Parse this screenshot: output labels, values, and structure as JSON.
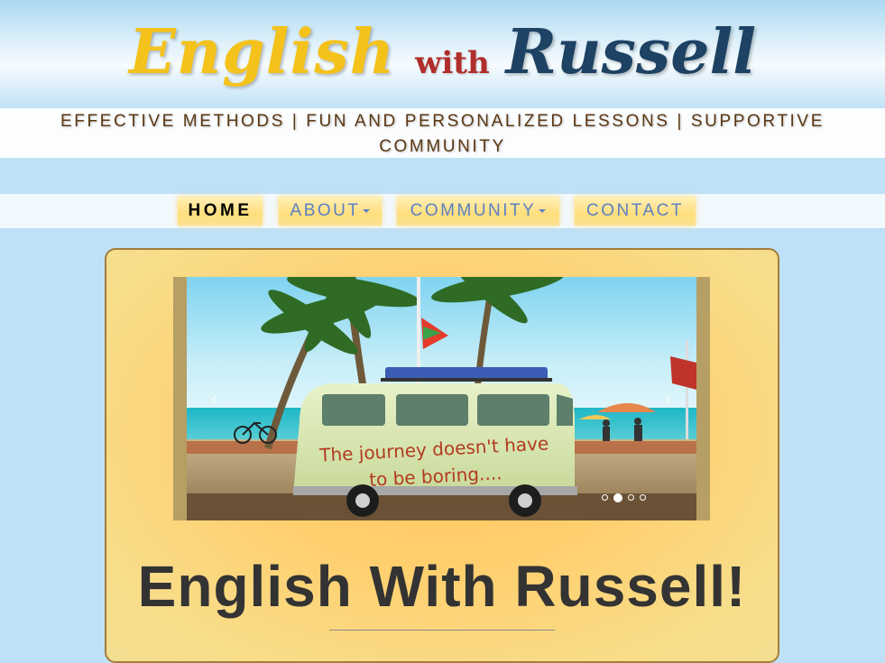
{
  "header": {
    "title_english": "English",
    "title_with": "with",
    "title_russell": "Russell",
    "tagline": "EFFECTIVE METHODS | FUN AND PERSONALIZED LESSONS | SUPPORTIVE COMMUNITY"
  },
  "nav": {
    "items": [
      {
        "label": "HOME",
        "active": true,
        "has_dropdown": false
      },
      {
        "label": "ABOUT",
        "active": false,
        "has_dropdown": true
      },
      {
        "label": "COMMUNITY",
        "active": false,
        "has_dropdown": true
      },
      {
        "label": "CONTACT",
        "active": false,
        "has_dropdown": false
      }
    ]
  },
  "slider": {
    "caption_line1": "The journey doesn't have",
    "caption_line2": "to be boring....",
    "prev_icon": "chevron-left-icon",
    "next_icon": "chevron-right-icon",
    "slide_count": 4,
    "active_slide": 2
  },
  "main": {
    "heading": "English With Russell!"
  },
  "colors": {
    "title_english": "#f4c21a",
    "title_with": "#b12d2a",
    "title_russell": "#1d4263",
    "tagline": "#5c3812",
    "nav_text": "#5b80c4",
    "card_background": "#ffd070",
    "page_background": "#bfe1f7"
  }
}
